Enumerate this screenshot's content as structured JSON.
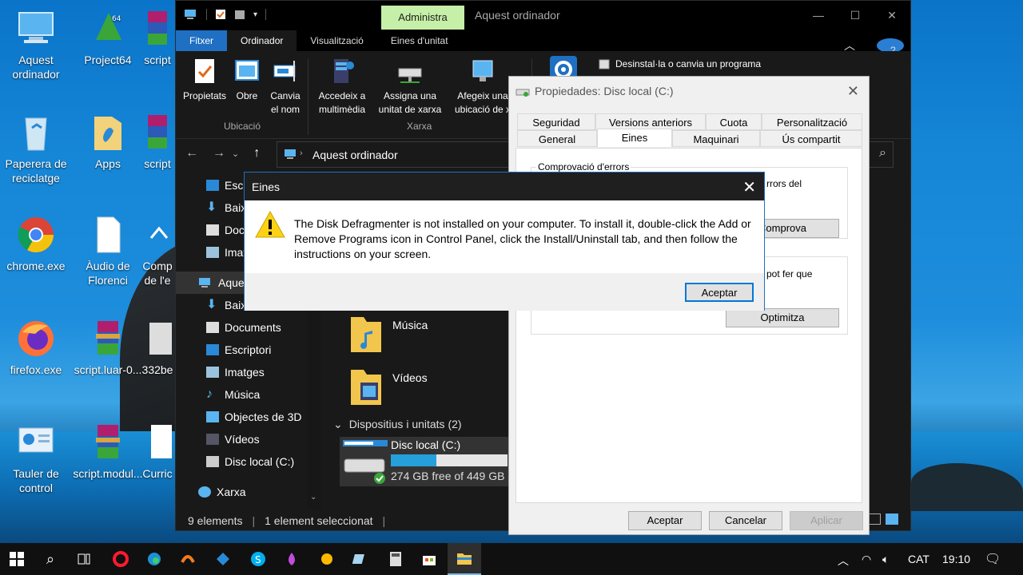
{
  "desktop": {
    "icons": [
      {
        "label": "Aquest ordinador"
      },
      {
        "label": "Project64"
      },
      {
        "label": "script"
      },
      {
        "label": "Paperera de reciclatge"
      },
      {
        "label": "Apps"
      },
      {
        "label": "script"
      },
      {
        "label": "chrome.exe"
      },
      {
        "label": "Àudio de Florenci"
      },
      {
        "label": "Comp de l'e"
      },
      {
        "label": "firefox.exe"
      },
      {
        "label": "script.luar-0..."
      },
      {
        "label": "332be"
      },
      {
        "label": "Tauler de control"
      },
      {
        "label": "script.modul..."
      },
      {
        "label": "Curric"
      }
    ]
  },
  "explorer": {
    "context_tab": "Administra",
    "title": "Aquest ordinador",
    "tabs": [
      "Fitxer",
      "Ordinador",
      "Visualització",
      "Eines d'unitat"
    ],
    "ribbon": {
      "propietats": "Propietats",
      "obre": "Obre",
      "canvia_nom": "Canvia el nom",
      "accedeix": "Accedeix a multimèdia",
      "assigna": "Assigna una unitat de xarxa",
      "afegeix": "Afegeix una ubicació de x",
      "desinstal": "Desinstal·la o canvia un programa",
      "group_ubicacio": "Ubicació",
      "group_xarxa": "Xarxa"
    },
    "address": "Aquest ordinador",
    "nav": [
      {
        "label": "Escri"
      },
      {
        "label": "Baix"
      },
      {
        "label": "Doc"
      },
      {
        "label": "Imat"
      },
      {
        "label": "Aque"
      },
      {
        "label": "Baix"
      },
      {
        "label": "Documents"
      },
      {
        "label": "Escriptori"
      },
      {
        "label": "Imatges"
      },
      {
        "label": "Música"
      },
      {
        "label": "Objectes de 3D"
      },
      {
        "label": "Vídeos"
      },
      {
        "label": "Disc local (C:)"
      },
      {
        "label": "Xarxa"
      }
    ],
    "content": {
      "musica": "Música",
      "videos": "Vídeos",
      "devices_header": "Dispositius i unitats (2)",
      "drive_name": "Disc local (C:)",
      "drive_free": "274 GB free of 449 GB",
      "drive_used_fraction": 0.39
    },
    "status": {
      "count": "9 elements",
      "selected": "1 element seleccionat"
    }
  },
  "properties": {
    "title": "Propiedades: Disc local (C:)",
    "tabs_row1": [
      "Seguridad",
      "Versions anteriors",
      "Cuota",
      "Personalització"
    ],
    "tabs_row2": [
      "General",
      "Eines",
      "Maquinari",
      "Ús compartit"
    ],
    "group1_title": "Comprovació d'errors",
    "group1_text": "rrors del",
    "comprova": "Comprova",
    "group2_text": "pot fer que",
    "optimitza": "Optimitza",
    "aceptar": "Aceptar",
    "cancelar": "Cancelar",
    "aplicar": "Aplicar"
  },
  "dialog": {
    "title": "Eines",
    "message": "The Disk Defragmenter is not installed on your computer. To install it, double-click the Add or Remove Programs icon in Control Panel, click the Install/Uninstall tab, and then follow the instructions on your screen.",
    "ok": "Aceptar"
  },
  "taskbar": {
    "lang": "CAT",
    "time": "19:10"
  }
}
